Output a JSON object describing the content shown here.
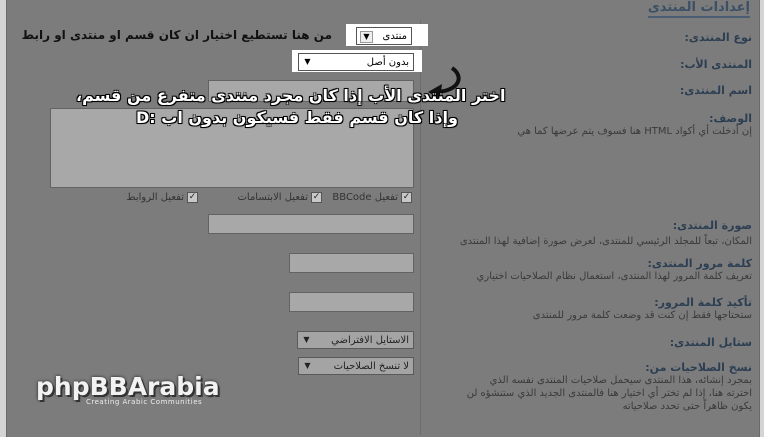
{
  "section_title": "إعدادات المنتدى",
  "tip_text": "من هنا تستطيع اختيار ان كان قسم او منتدى او رابط",
  "callout_text": {
    "line1": "اختر المنتدى الأب إذا كان مجرد منتدى متفرع من قسم،",
    "line2": "وإذا كان قسم فقط فسيكون بدون اب :D"
  },
  "forum_type": {
    "label": "نوع المنتدى:",
    "value": "منتدى"
  },
  "parent_forum": {
    "label": "المنتدى الأب:",
    "value": "بدون أصل"
  },
  "forum_name": {
    "label": "اسم المنتدى:",
    "value": ""
  },
  "description": {
    "label": "الوصف:",
    "hint": "إن أدخلت أي أكواد HTML هنا فسوف يتم عرضها كما هي",
    "value": ""
  },
  "checkboxes": [
    {
      "label": "تفعيل BBCode",
      "checked": true
    },
    {
      "label": "تفعيل الابتسامات",
      "checked": true
    },
    {
      "label": "تفعيل الروابط",
      "checked": true
    }
  ],
  "forum_image": {
    "label": "صورة المنتدى:",
    "hint1": "المكان، تبعاً للمجلد الرئيسي للمنتدى، لعرض صورة إضافية لهذا المنتدى",
    "value": ""
  },
  "forum_password": {
    "label": "كلمة مرور المنتدى:",
    "hint": "تعريف كلمة المرور لهذا المنتدى، استعمال نظام الصلاحيات اختياري",
    "value": ""
  },
  "confirm_password": {
    "label": "تأكيد كلمة المرور:",
    "hint": "ستحتاجها فقط إن كنت قد وضعت كلمة مرور للمنتدى",
    "value": ""
  },
  "forum_style": {
    "label": "ستايل المنتدى:",
    "value": "الاستايل الافتراضي"
  },
  "copy_permissions": {
    "label": "نسخ الصلاحيات من:",
    "value": "لا تنسخ الصلاحيات",
    "hint_lines": [
      "بمجرد إنشائه، هذا المنتدى سيحمل صلاحيات المنتدى نفسه الذي",
      "اخترته هنا، إذا لم تختر أي اختيار هنا فالمنتدى الجديد الذي ستنشؤه لن",
      "يكون ظاهراً حتى تحدد صلاحياته"
    ]
  },
  "logo": {
    "main": "phpBBArabia",
    "sub": "Creating Arabic Communities"
  }
}
